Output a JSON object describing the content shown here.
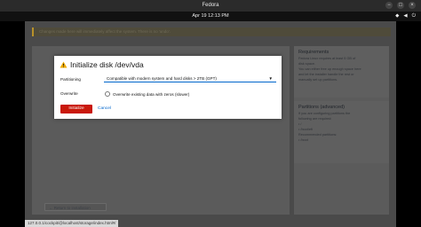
{
  "window": {
    "title": "Fedora",
    "buttons": [
      "−",
      "□",
      "×"
    ]
  },
  "topbar": {
    "clock": "Apr 19  12:13 PM",
    "tray": [
      "network-icon",
      "volume-icon",
      "power-icon"
    ]
  },
  "banner": {
    "text": "Changes made here will immediately affect the system. There is no 'undo'."
  },
  "sidebar": {
    "requirements_title": "Requirements",
    "requirements_text": [
      "Fedora Linux requires at least 5 GB of",
      "disk space.",
      "",
      "You can either free up enough space here",
      "and let the installer handle the rest or",
      "manually set up partitions."
    ],
    "partitions_title": "Partitions (advanced)",
    "partitions_text": [
      "If you are configuring partitions the",
      "following are required:",
      "",
      "• /",
      "• /boot/efi",
      "",
      "Recommended partitions:",
      "",
      "• /boot"
    ]
  },
  "back_button": "← Return to installation",
  "status_url": "127.0.0.1/cockpit/@localhost/storage/index.html#/",
  "dialog": {
    "title": "Initialize disk /dev/vda",
    "partitioning_label": "Partitioning",
    "partitioning_value": "Compatible with modern system and hard disks > 2TB (GPT)",
    "overwrite_label": "Overwrite",
    "overwrite_option": "Overwrite existing data with zeros (slower)",
    "initialize_button": "Initialize",
    "cancel_button": "Cancel"
  }
}
